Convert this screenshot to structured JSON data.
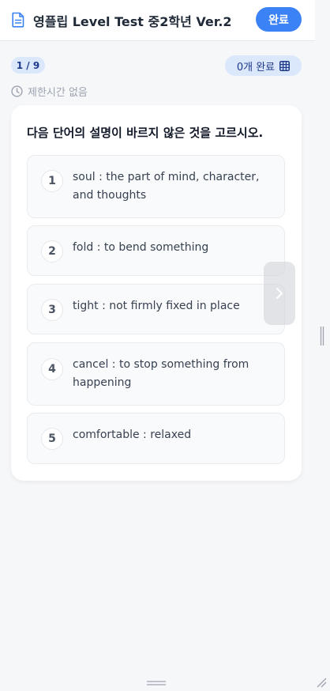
{
  "header": {
    "title": "영플립 Level Test 중2학년 Ver.2",
    "done_label": "완료"
  },
  "meta": {
    "progress": "1 / 9",
    "completed_label": "0개 완료",
    "time_limit": "제한시간 없음"
  },
  "question": {
    "text": "다음 단어의 설명이 바르지 않은 것을 고르시오.",
    "options": [
      {
        "number": "1",
        "text": "soul : the part of mind, character, and thoughts"
      },
      {
        "number": "2",
        "text": "fold : to bend something"
      },
      {
        "number": "3",
        "text": "tight : not firmly fixed in place"
      },
      {
        "number": "4",
        "text": "cancel : to stop something from happening"
      },
      {
        "number": "5",
        "text": "comfortable : relaxed"
      }
    ]
  },
  "icons": {
    "header": "document-icon",
    "completed": "grid-icon",
    "time": "clock-icon",
    "next": "chevron-right-icon"
  },
  "colors": {
    "accent": "#3b82f6",
    "pill_bg": "#dbe7fb",
    "pill_text": "#1e3a8a",
    "muted": "#9ca3af"
  }
}
